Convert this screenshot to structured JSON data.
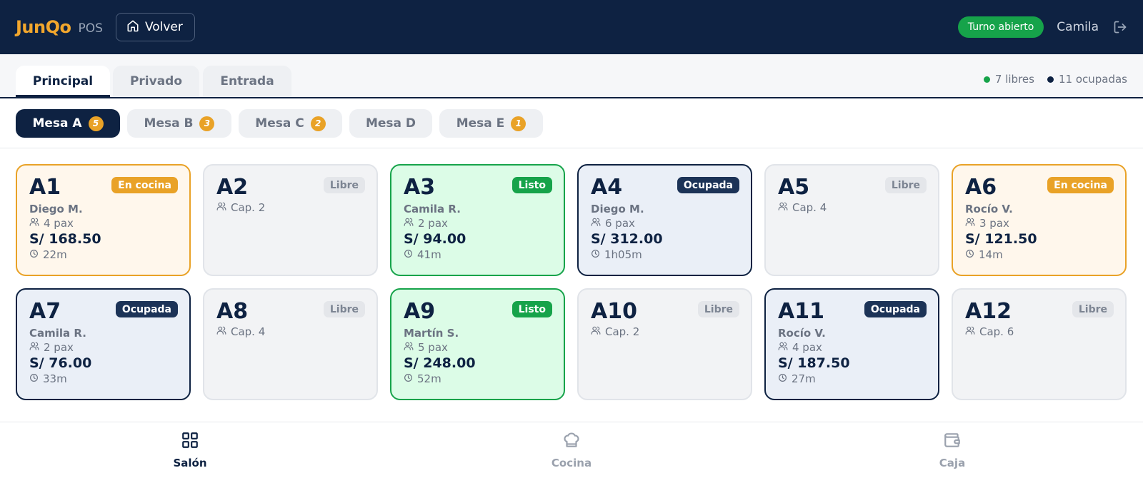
{
  "header": {
    "brand": "JunQo",
    "brand_sub": "POS",
    "back_label": "Volver",
    "shift_status": "Turno abierto",
    "user": "Camila"
  },
  "zones": {
    "tabs": [
      {
        "label": "Principal",
        "active": true
      },
      {
        "label": "Privado",
        "active": false
      },
      {
        "label": "Entrada",
        "active": false
      }
    ],
    "free_count": "7 libres",
    "occupied_count": "11 ocupadas"
  },
  "mesa_filters": [
    {
      "label": "Mesa A",
      "badge": "5",
      "active": true
    },
    {
      "label": "Mesa B",
      "badge": "3",
      "active": false
    },
    {
      "label": "Mesa C",
      "badge": "2",
      "active": false
    },
    {
      "label": "Mesa D",
      "badge": "",
      "active": false
    },
    {
      "label": "Mesa E",
      "badge": "1",
      "active": false
    }
  ],
  "tables": [
    {
      "name": "A1",
      "status": "En cocina",
      "kind": "cocina",
      "waiter": "Diego M.",
      "pax": "4 pax",
      "total": "S/ 168.50",
      "time": "22m"
    },
    {
      "name": "A2",
      "status": "Libre",
      "kind": "libre",
      "capacity": "Cap. 2"
    },
    {
      "name": "A3",
      "status": "Listo",
      "kind": "listo",
      "waiter": "Camila R.",
      "pax": "2 pax",
      "total": "S/ 94.00",
      "time": "41m"
    },
    {
      "name": "A4",
      "status": "Ocupada",
      "kind": "ocupada",
      "waiter": "Diego M.",
      "pax": "6 pax",
      "total": "S/ 312.00",
      "time": "1h05m"
    },
    {
      "name": "A5",
      "status": "Libre",
      "kind": "libre",
      "capacity": "Cap. 4"
    },
    {
      "name": "A6",
      "status": "En cocina",
      "kind": "cocina",
      "waiter": "Rocío V.",
      "pax": "3 pax",
      "total": "S/ 121.50",
      "time": "14m"
    },
    {
      "name": "A7",
      "status": "Ocupada",
      "kind": "ocupada",
      "waiter": "Camila R.",
      "pax": "2 pax",
      "total": "S/ 76.00",
      "time": "33m"
    },
    {
      "name": "A8",
      "status": "Libre",
      "kind": "libre",
      "capacity": "Cap. 4"
    },
    {
      "name": "A9",
      "status": "Listo",
      "kind": "listo",
      "waiter": "Martín S.",
      "pax": "5 pax",
      "total": "S/ 248.00",
      "time": "52m"
    },
    {
      "name": "A10",
      "status": "Libre",
      "kind": "libre",
      "capacity": "Cap. 2"
    },
    {
      "name": "A11",
      "status": "Ocupada",
      "kind": "ocupada",
      "waiter": "Rocío V.",
      "pax": "4 pax",
      "total": "S/ 187.50",
      "time": "27m"
    },
    {
      "name": "A12",
      "status": "Libre",
      "kind": "libre",
      "capacity": "Cap. 6"
    }
  ],
  "bottom_nav": [
    {
      "label": "Salón",
      "icon": "grid-icon",
      "active": true
    },
    {
      "label": "Cocina",
      "icon": "chef-hat-icon",
      "active": false
    },
    {
      "label": "Caja",
      "icon": "wallet-icon",
      "active": false
    }
  ],
  "colors": {
    "navy": "#0e2242",
    "accent": "#f2a72d",
    "green": "#16a34a",
    "amber": "#e9a227"
  }
}
